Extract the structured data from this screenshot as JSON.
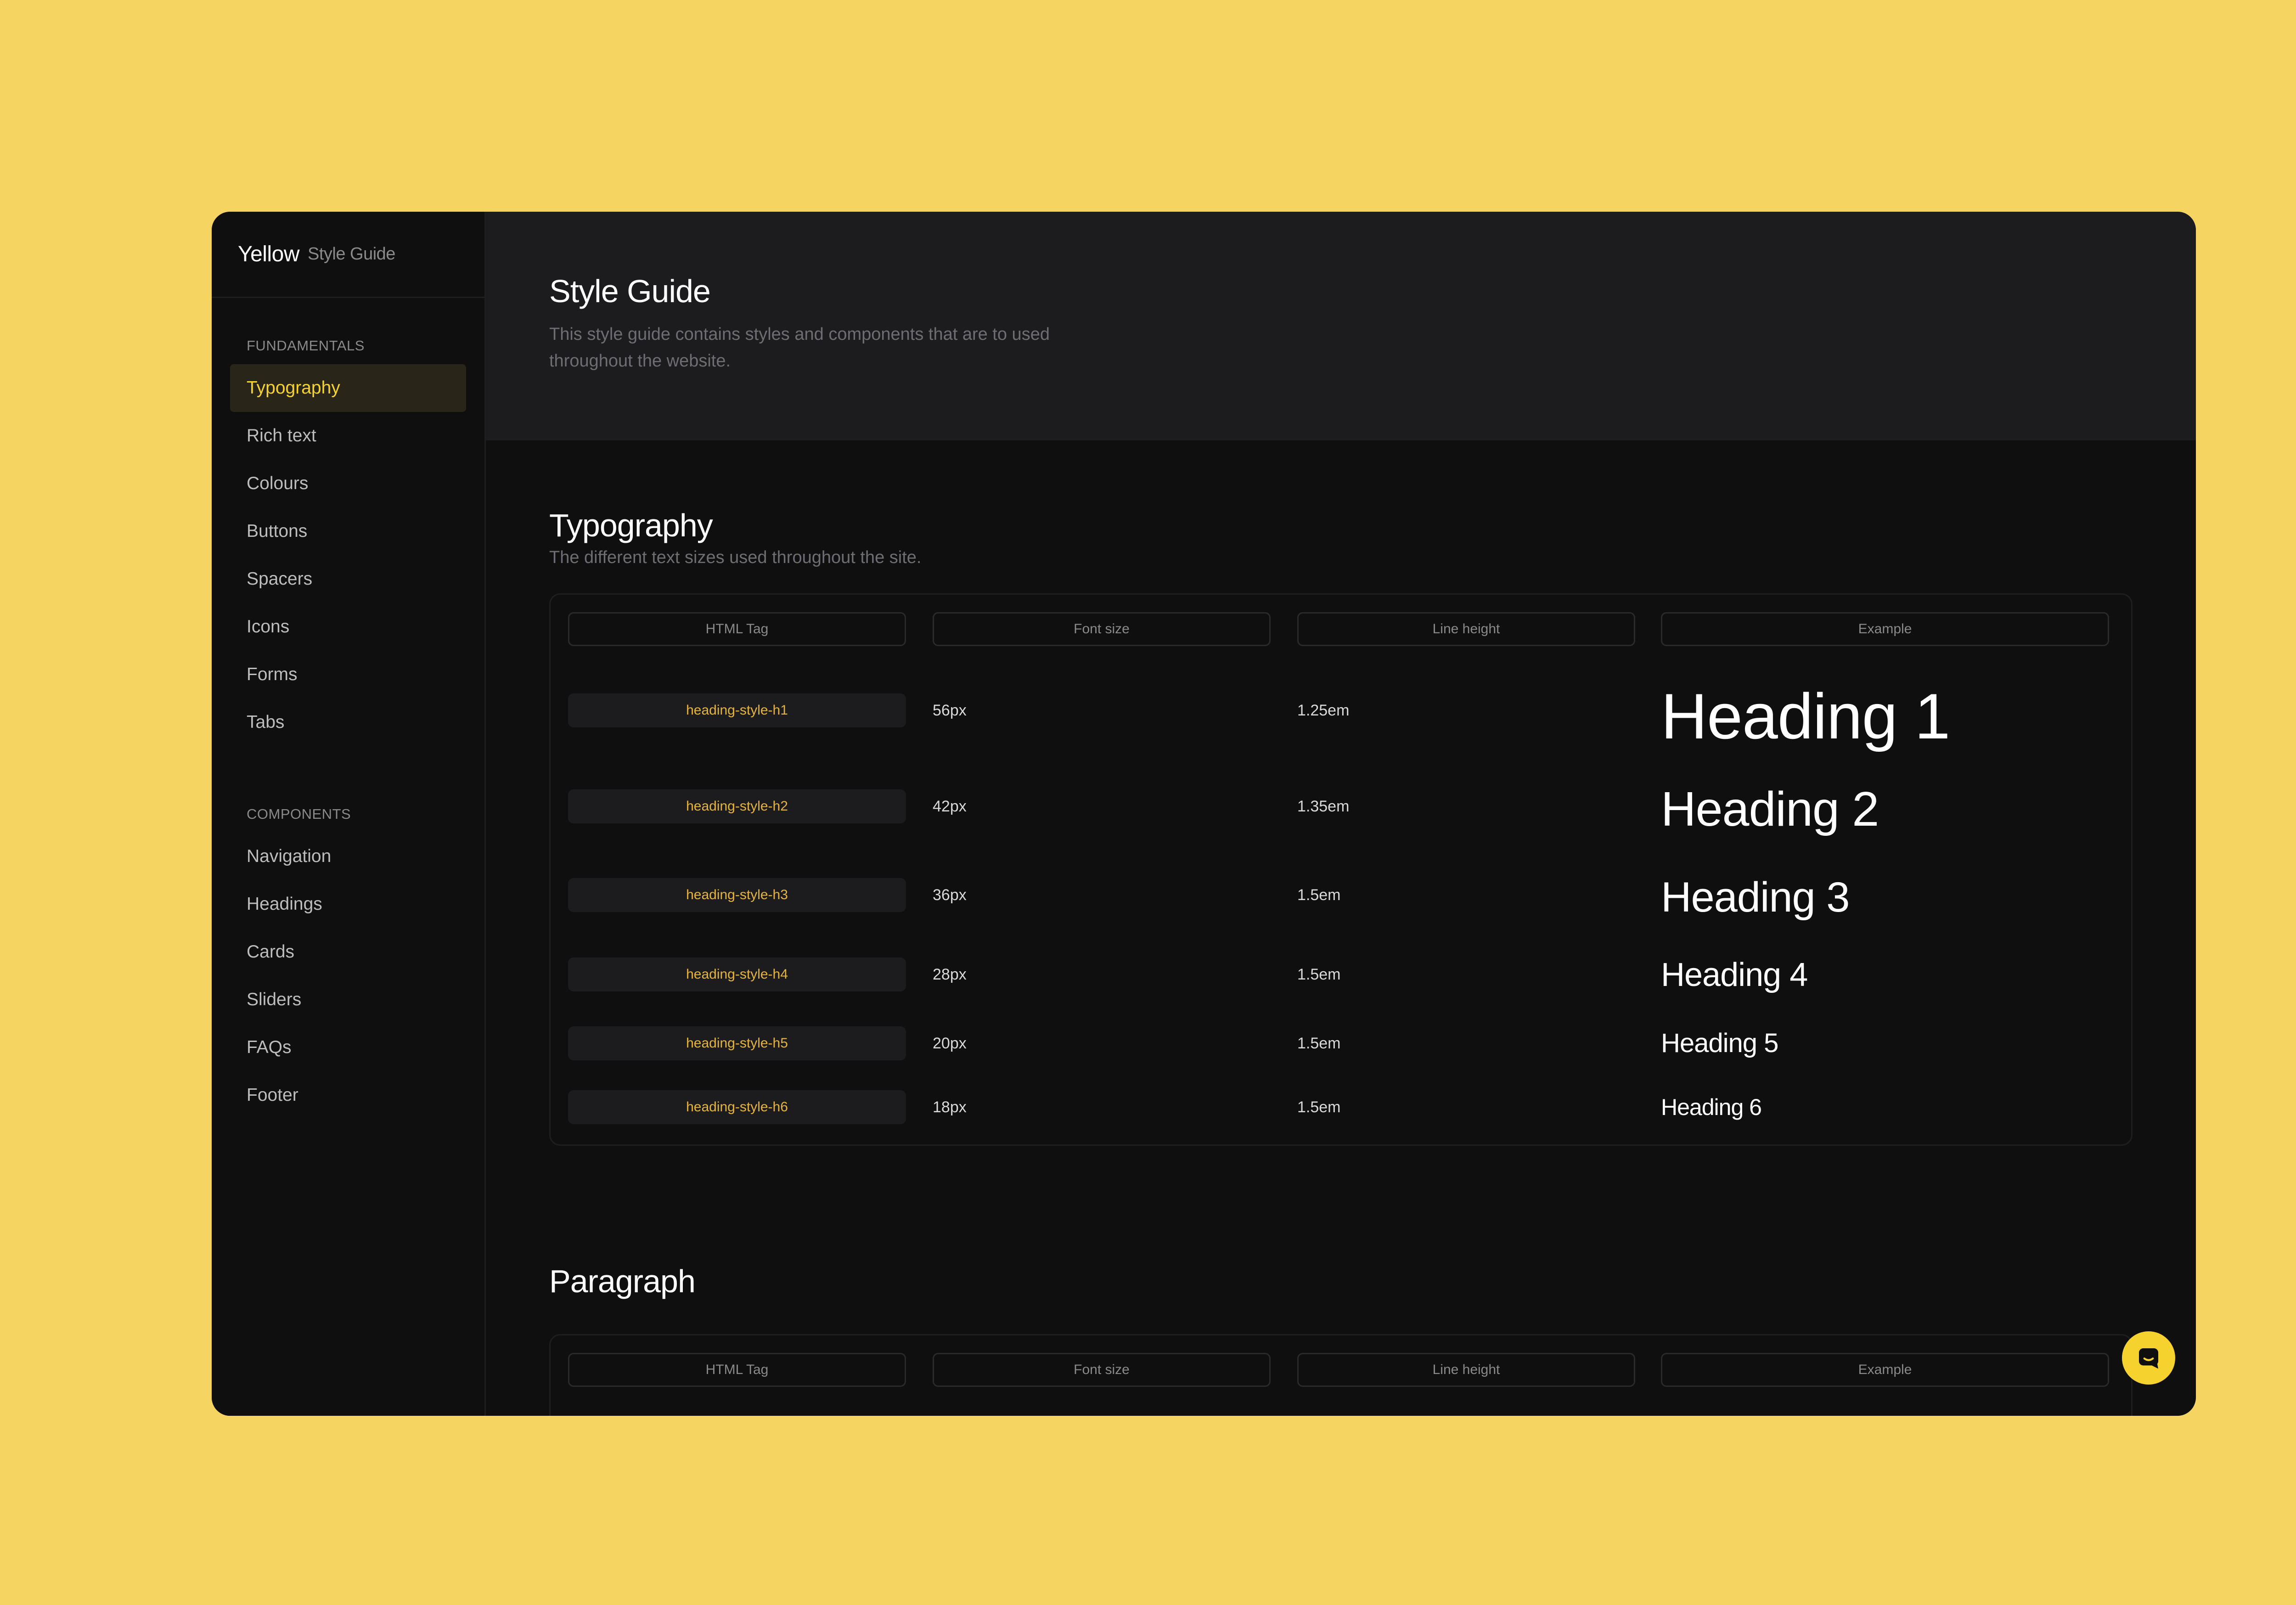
{
  "brand": {
    "name": "Yellow",
    "sub": "Style Guide"
  },
  "sidebar": {
    "fundamentals_label": "FUNDAMENTALS",
    "fundamentals": [
      {
        "label": "Typography",
        "active": true
      },
      {
        "label": "Rich text"
      },
      {
        "label": "Colours"
      },
      {
        "label": "Buttons"
      },
      {
        "label": "Spacers"
      },
      {
        "label": "Icons"
      },
      {
        "label": "Forms"
      },
      {
        "label": "Tabs"
      }
    ],
    "components_label": "COMPONENTS",
    "components": [
      {
        "label": "Navigation"
      },
      {
        "label": "Headings"
      },
      {
        "label": "Cards"
      },
      {
        "label": "Sliders"
      },
      {
        "label": "FAQs"
      },
      {
        "label": "Footer"
      }
    ]
  },
  "hero": {
    "title": "Style Guide",
    "desc": "This style guide contains styles and components that are to used throughout the website."
  },
  "typography": {
    "title": "Typography",
    "desc": "The different text sizes used throughout the site.",
    "headers": [
      "HTML Tag",
      "Font size",
      "Line height",
      "Example"
    ],
    "rows": [
      {
        "tag": "heading-style-h1",
        "size": "56px",
        "line_height": "1.25em",
        "example": "Heading 1"
      },
      {
        "tag": "heading-style-h2",
        "size": "42px",
        "line_height": "1.35em",
        "example": "Heading 2"
      },
      {
        "tag": "heading-style-h3",
        "size": "36px",
        "line_height": "1.5em",
        "example": "Heading 3"
      },
      {
        "tag": "heading-style-h4",
        "size": "28px",
        "line_height": "1.5em",
        "example": "Heading 4"
      },
      {
        "tag": "heading-style-h5",
        "size": "20px",
        "line_height": "1.5em",
        "example": "Heading 5"
      },
      {
        "tag": "heading-style-h6",
        "size": "18px",
        "line_height": "1.5em",
        "example": "Heading 6"
      }
    ]
  },
  "paragraph": {
    "title": "Paragraph",
    "headers": [
      "HTML Tag",
      "Font size",
      "Line height",
      "Example"
    ]
  },
  "chat": {
    "icon": "chat-icon"
  },
  "colors": {
    "background": "#F5D461",
    "window": "#0F0F0F",
    "accent": "#F5D22E"
  }
}
